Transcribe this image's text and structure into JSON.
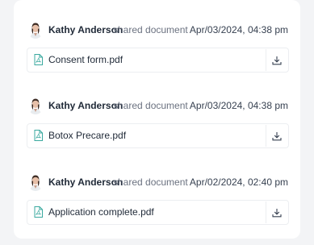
{
  "entries": [
    {
      "user": "Kathy Anderson",
      "action": "shared document",
      "timestamp": "Apr/03/2024, 04:38 pm",
      "file": "Consent form.pdf",
      "avatar_icon": "user-avatar"
    },
    {
      "user": "Kathy Anderson",
      "action": "shared document",
      "timestamp": "Apr/03/2024, 04:38 pm",
      "file": "Botox Precare.pdf",
      "avatar_icon": "user-avatar"
    },
    {
      "user": "Kathy Anderson",
      "action": "shared document",
      "timestamp": "Apr/02/2024, 02:40 pm",
      "file": "Application complete.pdf",
      "avatar_icon": "user-avatar"
    }
  ],
  "icons": {
    "file": "pdf-file-icon",
    "download": "download-icon"
  },
  "colors": {
    "accent": "#3aa99f",
    "muted": "#6b7280",
    "background": "#f3f4f6"
  }
}
